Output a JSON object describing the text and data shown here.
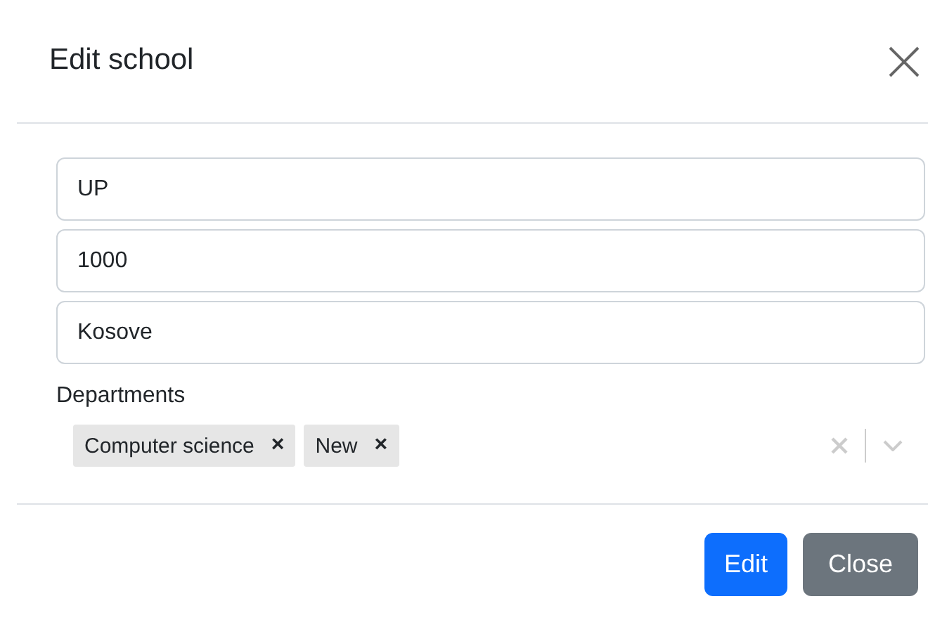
{
  "dialog": {
    "title": "Edit school"
  },
  "fields": [
    {
      "value": "UP"
    },
    {
      "value": "1000"
    },
    {
      "value": "Kosove"
    }
  ],
  "departments": {
    "label": "Departments",
    "tags": [
      {
        "label": "Computer science",
        "remove": "×"
      },
      {
        "label": "New",
        "remove": "×"
      }
    ]
  },
  "buttons": [
    {
      "label": "Edit",
      "kind": "primary"
    },
    {
      "label": "Close",
      "kind": "secondary"
    }
  ]
}
